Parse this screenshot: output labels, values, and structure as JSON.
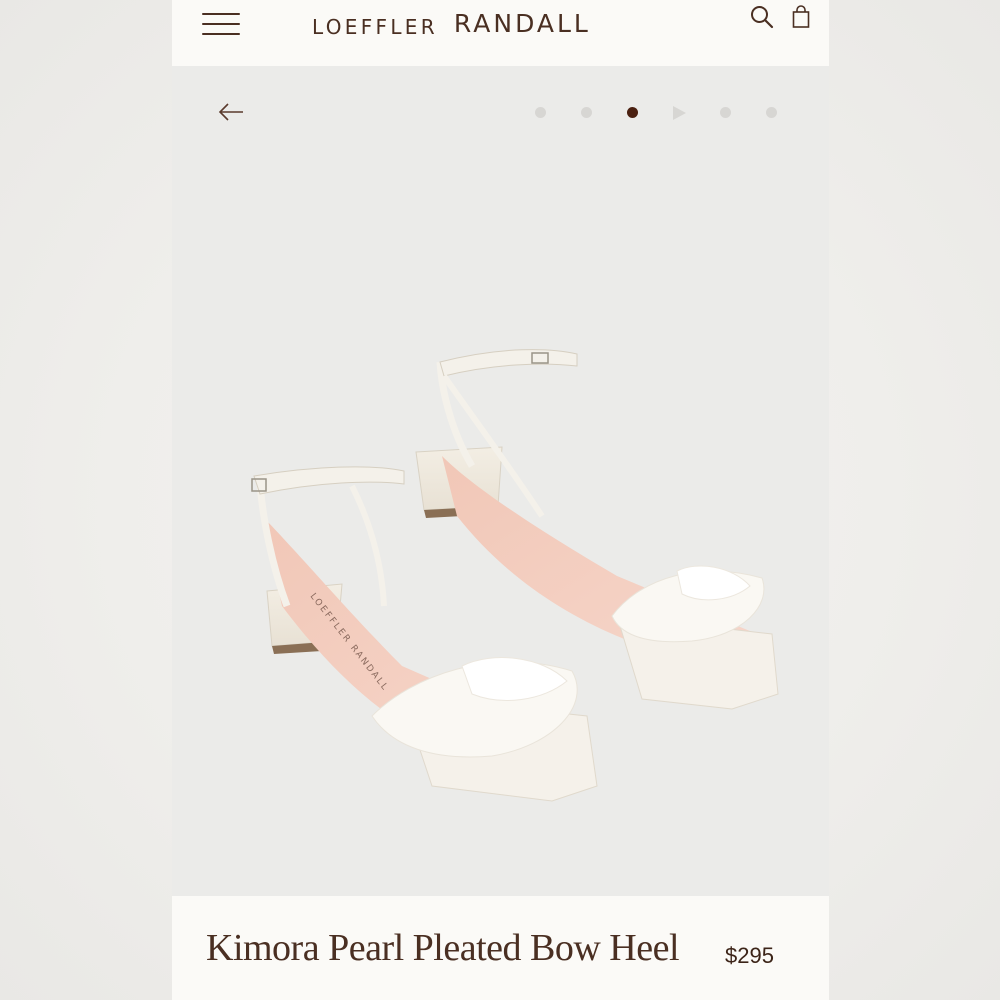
{
  "header": {
    "brand_first": "LOEFFLER",
    "brand_second": "RANDALL",
    "icons": [
      "menu-icon",
      "search-icon",
      "bag-icon"
    ]
  },
  "gallery": {
    "back_icon": "arrow-left-icon",
    "slide_count": 6,
    "active_slide": 3,
    "video_slide": 4,
    "image_subject": "white ankle-strap block heel sandals with pleated bow",
    "insole_text": "LOEFFLER RANDALL"
  },
  "product": {
    "name": "Kimora Pearl Pleated Bow Heel",
    "price": "$295"
  },
  "colors": {
    "brand_brown": "#4a2f22",
    "active_dot": "#4a2010",
    "inactive_dot": "#d7d6d3",
    "header_bg": "#fbfaf7",
    "gallery_bg": "#ebebe9"
  }
}
